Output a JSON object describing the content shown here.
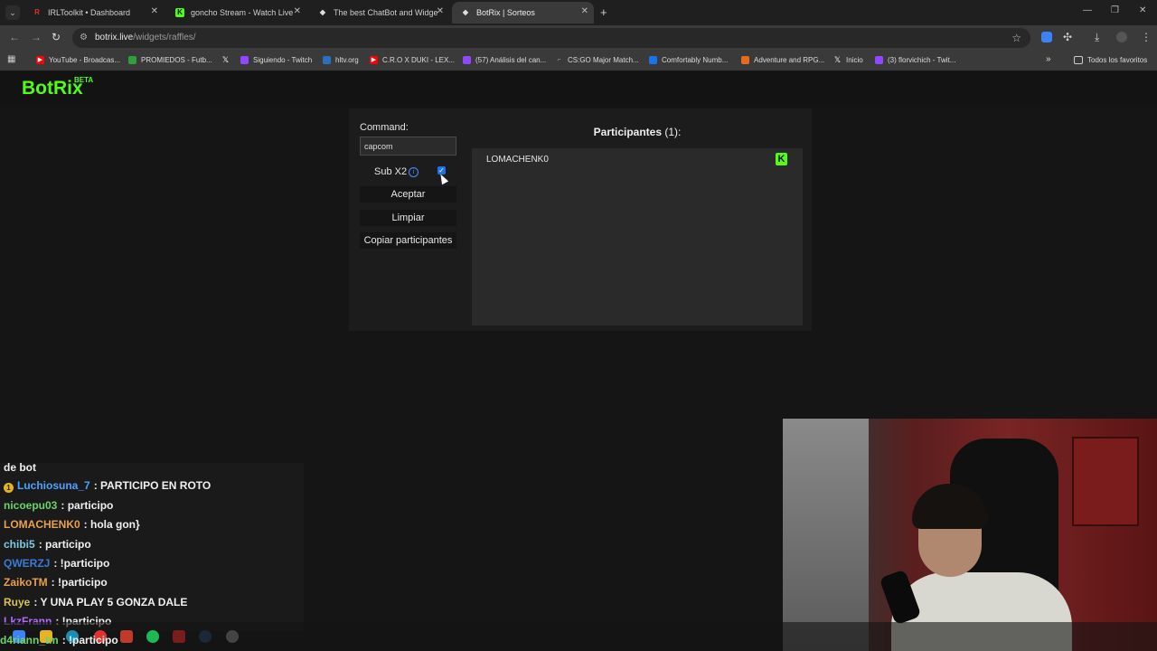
{
  "tabs": [
    {
      "title": "IRLToolkit • Dashboard",
      "favicon": "R",
      "favicon_color": "#e03030"
    },
    {
      "title": "goncho Stream - Watch Live on",
      "favicon": "K",
      "favicon_color": "#53fc18"
    },
    {
      "title": "The best ChatBot and Widgets",
      "favicon": "◆",
      "favicon_color": "#dddddd"
    },
    {
      "title": "BotRix | Sorteos",
      "favicon": "◆",
      "favicon_color": "#dddddd"
    }
  ],
  "address_bar": {
    "host": "botrix.live",
    "path": "/widgets/raffles/"
  },
  "bookmarks": [
    {
      "label": "YouTube - Broadcas...",
      "color": "#ff0000"
    },
    {
      "label": "PROMIEDOS - Futb...",
      "color": "#2e9e3e"
    },
    {
      "label": "",
      "color": "#ffffff"
    },
    {
      "label": "Siguiendo - Twitch",
      "color": "#9146ff"
    },
    {
      "label": "hltv.org",
      "color": "#2c6fbd"
    },
    {
      "label": "C.R.O X DUKI - LEX...",
      "color": "#ff0000"
    },
    {
      "label": "(57) Análisis del can...",
      "color": "#9146ff"
    },
    {
      "label": "CS:GO Major Match...",
      "color": "#aaaaaa"
    },
    {
      "label": "Comfortably Numb...",
      "color": "#1a73e8"
    },
    {
      "label": "Adventure and RPG...",
      "color": "#e86a1a"
    },
    {
      "label": "Inicio",
      "color": "#ffffff"
    },
    {
      "label": "(3) florvichich - Twit...",
      "color": "#9146ff"
    }
  ],
  "bookmarks_all": "Todos los favoritos",
  "app": {
    "logo": "BotRix",
    "beta": "BETA"
  },
  "raffle": {
    "command_label": "Command:",
    "command_value": "capcom",
    "sub_label": "Sub X2",
    "sub_checked": true,
    "accept_label": "Aceptar",
    "clear_label": "Limpiar",
    "copy_label": "Copiar participantes",
    "participants_title": "Participantes",
    "participants_count": "(1):",
    "participants": [
      {
        "name": "LOMACHENK0",
        "platform": "kick"
      }
    ]
  },
  "chat": {
    "header": "de bot",
    "messages": [
      {
        "user": "Luchiosuna_7",
        "color": "#4aa3ff",
        "text": ": PARTICIPO EN ROTO",
        "badge": true
      },
      {
        "user": "nicoepu03",
        "color": "#6bd36b",
        "text": ": participo",
        "badge": false
      },
      {
        "user": "LOMACHENK0",
        "color": "#e8a04a",
        "text": ": hola gon}",
        "badge": false
      },
      {
        "user": "chibi5",
        "color": "#7ec8e3",
        "text": ": participo",
        "badge": false
      },
      {
        "user": "QWERZJ",
        "color": "#3a7bd5",
        "text": ": !participo",
        "badge": false
      },
      {
        "user": "ZaikoTM",
        "color": "#e8a04a",
        "text": ": !participo",
        "badge": false
      },
      {
        "user": "Ruye",
        "color": "#d9c34a",
        "text": ": Y UNA PLAY 5 GONZA DALE",
        "badge": false
      },
      {
        "user": "LkzFrann",
        "color": "#b36bff",
        "text": ": !participo",
        "badge": false
      },
      {
        "user": "d4riann_tm",
        "color": "#6bd36b",
        "text": ": !participo",
        "badge": false
      }
    ]
  }
}
